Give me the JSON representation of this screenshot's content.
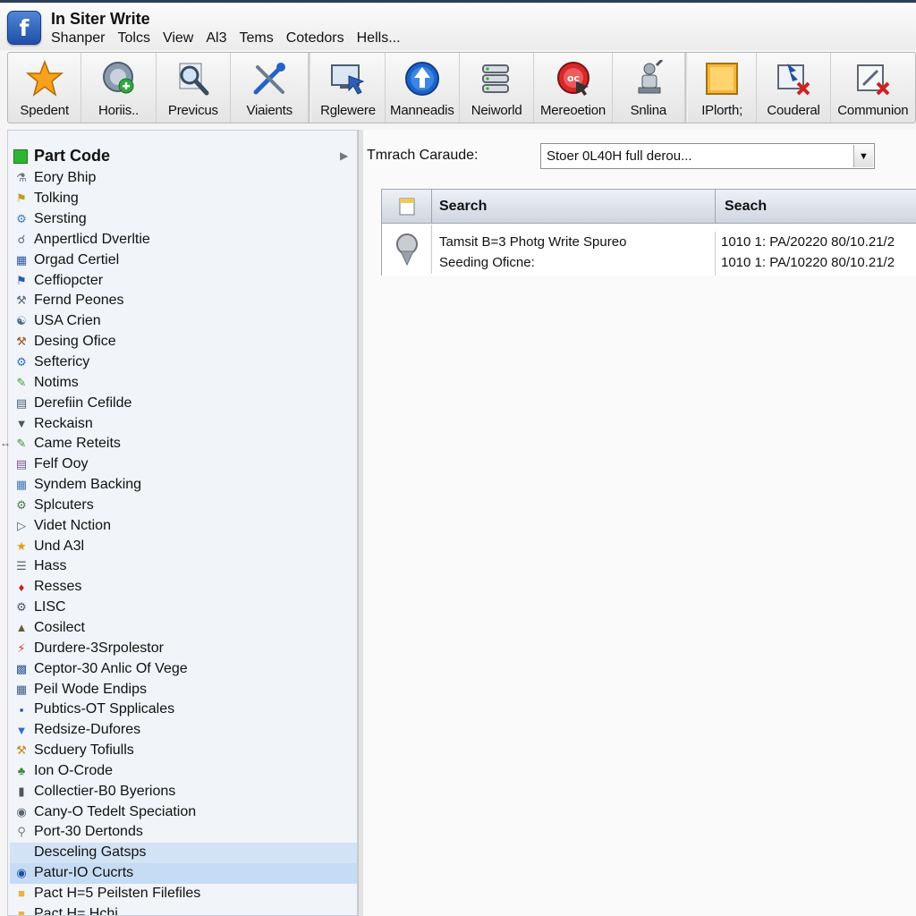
{
  "app": {
    "logo_letter": "f",
    "title": "In Siter Write"
  },
  "menu": [
    "Shanper",
    "Tolcs",
    "View",
    "Al3",
    "Tems",
    "Cotedors",
    "Hells..."
  ],
  "toolbar": [
    {
      "label": "Spedent",
      "icon": "star-icon"
    },
    {
      "label": "Horiis..",
      "icon": "globe-add-icon"
    },
    {
      "label": "Previcus",
      "icon": "magnifier-icon"
    },
    {
      "label": "Viaients",
      "icon": "tools-icon"
    },
    {
      "label": "Rglewere",
      "icon": "monitor-arrow-icon"
    },
    {
      "label": "Manneadis",
      "icon": "upload-globe-icon"
    },
    {
      "label": "Neiworld",
      "icon": "network-server-icon"
    },
    {
      "label": "Mereoetion",
      "icon": "stop-record-icon"
    },
    {
      "label": "Snlina",
      "icon": "user-tool-icon"
    },
    {
      "label": "IPlorth;",
      "icon": "folder-icon"
    },
    {
      "label": "Couderal",
      "icon": "delete-connection-icon"
    },
    {
      "label": "Communion",
      "icon": "edit-delete-icon"
    }
  ],
  "tree": {
    "root_label": "Part Code",
    "items": [
      {
        "label": "Eory Bhip",
        "icon": "person-icon"
      },
      {
        "label": "Tolking",
        "icon": "trophy-icon"
      },
      {
        "label": "Sersting",
        "icon": "settings-icon"
      },
      {
        "label": "Anpertlicd Dverltie",
        "icon": "lock-icon"
      },
      {
        "label": "Orgad Certiel",
        "icon": "certificate-icon"
      },
      {
        "label": "Ceffiopcter",
        "icon": "flag-icon"
      },
      {
        "label": "Fernd Peones",
        "icon": "tool-icon"
      },
      {
        "label": "USA Crien",
        "icon": "user-group-icon"
      },
      {
        "label": "Desing Ofice",
        "icon": "office-icon"
      },
      {
        "label": "Seftericy",
        "icon": "security-icon"
      },
      {
        "label": "Notims",
        "icon": "pen-icon"
      },
      {
        "label": "Derefiin Cefilde",
        "icon": "file-icon"
      },
      {
        "label": "Reckaisn",
        "icon": "funnel-icon"
      },
      {
        "label": "Came Reteits",
        "icon": "pencil-icon"
      },
      {
        "label": "Felf Ooy",
        "icon": "document-icon"
      },
      {
        "label": "Syndem Backing",
        "icon": "backup-icon"
      },
      {
        "label": "Splcuters",
        "icon": "gear-icon"
      },
      {
        "label": "Videt Nction",
        "icon": "video-icon"
      },
      {
        "label": "Und A3l",
        "icon": "star-icon"
      },
      {
        "label": "Hass",
        "icon": "list-icon"
      },
      {
        "label": "Resses",
        "icon": "red-gem-icon"
      },
      {
        "label": "LISC",
        "icon": "bottle-icon"
      },
      {
        "label": "Cosilect",
        "icon": "bell-icon"
      },
      {
        "label": "Durdere-3Srpolestor",
        "icon": "plug-icon"
      },
      {
        "label": "Ceptor-30 Anlic Of Vege",
        "icon": "monitor-icon"
      },
      {
        "label": "Peil Wode Endips",
        "icon": "table-icon"
      },
      {
        "label": "Pubtics-OT Spplicales",
        "icon": "book-icon"
      },
      {
        "label": "Redsize-Dufores",
        "icon": "triangle-icon"
      },
      {
        "label": "Scduery Tofiulls",
        "icon": "wrench-icon"
      },
      {
        "label": "Ion O-Crode",
        "icon": "tree-icon"
      },
      {
        "label": "Collectier-B0 Byerions",
        "icon": "column-icon"
      },
      {
        "label": "Cany-O Tedelt Speciation",
        "icon": "disc-icon"
      },
      {
        "label": "Port-30 Dertonds",
        "icon": "key-icon"
      },
      {
        "label": "Desceling Gatsps",
        "icon": "none",
        "state": "highlight"
      },
      {
        "label": "Patur-IO Cucrts",
        "icon": "globe-icon",
        "state": "selected"
      },
      {
        "label": "Pact H=5 Peilsten Filefiles",
        "icon": "folder-icon"
      },
      {
        "label": "Pact H= Hchi",
        "icon": "folder-icon"
      }
    ]
  },
  "filter": {
    "label": "Tmrach Caraude:",
    "value": "Stoer 0L40H full derou..."
  },
  "grid": {
    "headers": [
      "Search",
      "Seach"
    ],
    "rows": [
      {
        "col1": [
          "Tamsit B=3 Photg Write Spureo",
          "Seeding Oficne:"
        ],
        "col2": [
          "1010 1: PA/20220 80/10.21/2",
          "1010 1: PA/10220 80/10.21/2"
        ]
      }
    ]
  },
  "colors": {
    "accent": "#1f4fa6",
    "selection": "#c6dcf5",
    "root_marker": "#2fb534"
  }
}
